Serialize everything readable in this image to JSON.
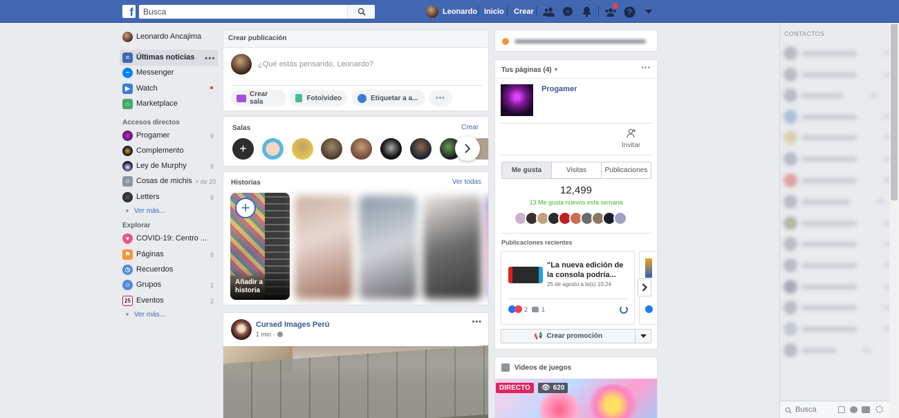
{
  "topbar": {
    "search_placeholder": "Busca",
    "user_name": "Leonardo",
    "home_label": "Inicio",
    "create_label": "Crear"
  },
  "left_nav": {
    "profile_name": "Leonardo Ancajima",
    "main_items": [
      {
        "label": "Últimas noticias",
        "icon": "news-feed-icon"
      },
      {
        "label": "Messenger",
        "icon": "messenger-icon"
      },
      {
        "label": "Watch",
        "icon": "watch-icon"
      },
      {
        "label": "Marketplace",
        "icon": "marketplace-icon"
      }
    ],
    "shortcuts_heading": "Accesos directos",
    "shortcuts": [
      {
        "label": "Progamer",
        "count": "9"
      },
      {
        "label": "Complemento",
        "count": ""
      },
      {
        "label": "Ley de Murphy",
        "count": "9"
      },
      {
        "label": "Cosas de michis",
        "count": "+ de 20"
      },
      {
        "label": "Letters",
        "count": "9"
      }
    ],
    "see_more_1": "Ver más...",
    "explore_heading": "Explorar",
    "explore": [
      {
        "label": "COVID-19: Centro ...",
        "count": ""
      },
      {
        "label": "Páginas",
        "count": "9"
      },
      {
        "label": "Recuerdos",
        "count": ""
      },
      {
        "label": "Grupos",
        "count": "1"
      },
      {
        "label": "Eventos",
        "count": "2"
      }
    ],
    "see_more_2": "Ver más..."
  },
  "composer": {
    "title": "Crear publicación",
    "placeholder": "¿Qué estás pensando, Leonardo?",
    "btn_room": "Crear sala",
    "btn_photo": "Foto/video",
    "btn_tag": "Etiquetar a a..."
  },
  "rooms": {
    "title": "Salas",
    "create": "Crear"
  },
  "stories": {
    "title": "Historias",
    "see_all": "Ver todas",
    "add_line1": "Añadir a",
    "add_line2": "historia"
  },
  "post": {
    "author": "Cursed Images Perú",
    "time": "1 min ·"
  },
  "pages_panel": {
    "title": "Tus páginas (4)",
    "page_name": "Progamer",
    "invite": "Invitar",
    "tabs": [
      "Me gusta",
      "Visitas",
      "Publicaciones"
    ],
    "likes": "12,499",
    "new_likes": "13 Me gusta nuevos esta semana",
    "recent_title": "Publicaciones recientes",
    "recent_post_text": "\"La nueva edición de la consola podría...",
    "recent_post_date": "25 de agosto a la(s) 10:24",
    "reaction_count": "2",
    "comment_count": "1",
    "promote": "Crear promoción"
  },
  "games": {
    "title": "Videos de juegos",
    "live": "DIRECTO",
    "viewers": "620"
  },
  "contacts": {
    "title": "CONTACTOS",
    "search_placeholder": "Busca"
  },
  "colors": {
    "brand": "#4267b2",
    "background": "#e9ebee",
    "link": "#385898",
    "green": "#42b72a",
    "live_red": "#e0245e"
  }
}
